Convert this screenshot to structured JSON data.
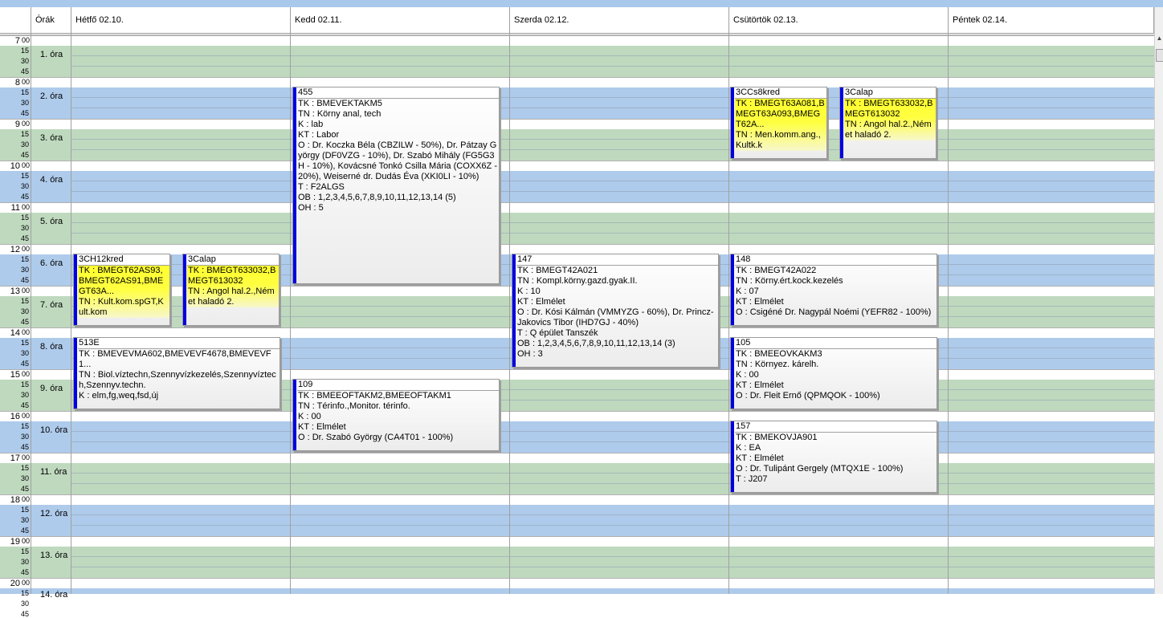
{
  "header": {
    "orak_label": "Órák",
    "days": [
      "Hétfő  02.10.",
      "Kedd  02.11.",
      "Szerda  02.12.",
      "Csütörtök  02.13.",
      "Péntek  02.14."
    ]
  },
  "hours": [
    "7",
    "8",
    "9",
    "10",
    "11",
    "12",
    "13",
    "14",
    "15",
    "16",
    "17",
    "18",
    "19",
    "20"
  ],
  "zero_minutes": "00",
  "minutes": [
    "15",
    "30",
    "45"
  ],
  "ora_labels": [
    "1. óra",
    "2. óra",
    "3. óra",
    "4. óra",
    "5. óra",
    "6. óra",
    "7. óra",
    "8. óra",
    "9. óra",
    "10. óra",
    "11. óra",
    "12. óra",
    "13. óra"
  ],
  "colors": {
    "green_band": "#bfd9bf",
    "blue_band": "#aecbeb",
    "event_bar": "#0000e0",
    "yellow": "#ffff30"
  },
  "events": [
    {
      "id": "kedd-455",
      "title": "455",
      "lines": [
        "TK : BMEVEKTAKM5",
        "TN : Körny anal, tech",
        "K : lab",
        "KT : Labor",
        "O :  Dr. Koczka Béla (CBZILW - 50%), Dr. Pátzay György (DF0VZG - 10%), Dr. Szabó Mihály (FG5G3H - 10%), Kovácsné Tonkó Csilla Mária (COXX6Z - 20%), Weiserné dr. Dudás Éva (XKI0LI - 10%)",
        "T : F2ALGS",
        "OB : 1,2,3,4,5,6,7,8,9,10,11,12,13,14 (5)",
        "OH : 5"
      ]
    },
    {
      "id": "cs-3ccs8kred",
      "title": "3CCs8kred",
      "lines": [
        "TK : BMEGT63A081,BMEGT63A093,BMEGT62A...",
        "TN : Men.komm.ang.,Kultk.k"
      ]
    },
    {
      "id": "cs-3calap",
      "title": "3Calap",
      "lines": [
        "TK : BMEGT633032,BMEGT613032",
        "TN : Angol hal.2.,Német haladó 2."
      ]
    },
    {
      "id": "h-3ch12kred",
      "title": "3CH12kred",
      "lines": [
        "TK : BMEGT62AS93,BMEGT62AS91,BMEGT63A...",
        "TN : Kult.kom.spGT,Kult.kom"
      ]
    },
    {
      "id": "h-3calap",
      "title": "3Calap",
      "lines": [
        "TK : BMEGT633032,BMEGT613032",
        "TN : Angol hal.2.,Német haladó 2."
      ]
    },
    {
      "id": "sz-147",
      "title": "147",
      "lines": [
        "TK : BMEGT42A021",
        "TN : Kompl.körny.gazd.gyak.II.",
        "K : 10",
        "KT : Elmélet",
        "O :  Dr. Kósi Kálmán (VMMYZG - 60%), Dr. Princz-Jakovics Tibor (IHD7GJ - 40%)",
        "T : Q épület Tanszék",
        "OB : 1,2,3,4,5,6,7,8,9,10,11,12,13,14 (3)",
        "OH : 3"
      ]
    },
    {
      "id": "cs-148",
      "title": "148",
      "lines": [
        "TK : BMEGT42A022",
        "TN : Körny.ért.kock.kezelés",
        "K : 07",
        "KT : Elmélet",
        "O :  Csigéné Dr. Nagypál Noémi (YEFR82 - 100%)"
      ]
    },
    {
      "id": "h-513e",
      "title": "513E",
      "lines": [
        "TK : BMEVEVMA602,BMEVEVF4678,BMEVEVF1...",
        "TN : Biol.víztechn,Szennyvízkezelés,Szennyvíztech,Szennyv.techn.",
        "K : elm,fg,weq,fsd,új"
      ]
    },
    {
      "id": "cs-105",
      "title": "105",
      "lines": [
        "TK : BMEEOVKAKM3",
        "TN : Környez. kárelh.",
        "K : 00",
        "KT : Elmélet",
        "O :  Dr. Fleit Ernő (QPMQOK - 100%)"
      ]
    },
    {
      "id": "k-109",
      "title": "109",
      "lines": [
        "TK : BMEEOFTAKM2,BMEEOFTAKM1",
        "TN : Térinfo.,Monitor. térinfo.",
        "K : 00",
        "KT : Elmélet",
        "O :  Dr. Szabó György (CA4T01 - 100%)"
      ]
    },
    {
      "id": "cs-157",
      "title": "157",
      "lines": [
        "TK : BMEKOVJA901",
        "K : EA",
        "KT : Elmélet",
        "O :  Dr. Tulipánt Gergely (MTQX1E - 100%)",
        "T : J207"
      ]
    }
  ],
  "last_ora_partial": "14. óra"
}
